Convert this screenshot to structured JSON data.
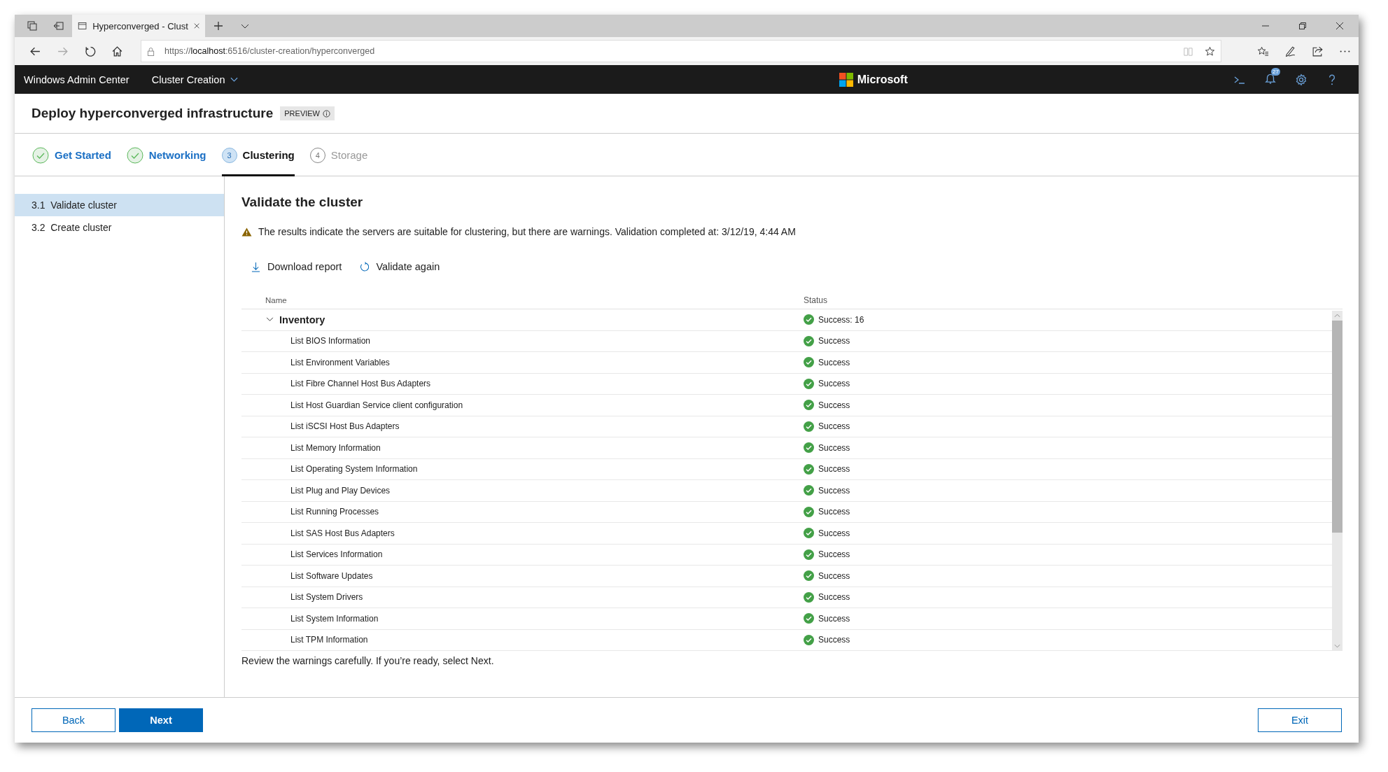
{
  "browser": {
    "tab_title": "Hyperconverged - Clust",
    "url_prefix": "https://",
    "url_host": "localhost",
    "url_rest": ":6516/cluster-creation/hyperconverged"
  },
  "app_header": {
    "app_name": "Windows Admin Center",
    "context": "Cluster Creation",
    "brand": "Microsoft",
    "notification_count": "27"
  },
  "page": {
    "title": "Deploy hyperconverged infrastructure",
    "badge": "PREVIEW"
  },
  "steps": [
    {
      "label": "Get Started",
      "kind": "done",
      "selected": false
    },
    {
      "label": "Networking",
      "kind": "done",
      "selected": false
    },
    {
      "label": "Clustering",
      "number": "3",
      "kind": "current",
      "selected": true
    },
    {
      "label": "Storage",
      "number": "4",
      "kind": "upcoming",
      "selected": false
    }
  ],
  "sidebar": {
    "items": [
      {
        "label": "3.1  Validate cluster",
        "selected": true
      },
      {
        "label": "3.2  Create cluster",
        "selected": false
      }
    ]
  },
  "content": {
    "heading": "Validate the cluster",
    "warning": "The results indicate the servers are suitable for clustering, but there are warnings. Validation completed at: 3/12/19, 4:44 AM",
    "actions": [
      {
        "kind": "download",
        "label": "Download report"
      },
      {
        "kind": "refresh",
        "label": "Validate again"
      }
    ],
    "table": {
      "columns": [
        "Name",
        "Status"
      ],
      "groups": [
        {
          "name": "Inventory",
          "status": "Success: 16",
          "expanded": true,
          "children": [
            {
              "name": "List BIOS Information",
              "status": "Success"
            },
            {
              "name": "List Environment Variables",
              "status": "Success"
            },
            {
              "name": "List Fibre Channel Host Bus Adapters",
              "status": "Success"
            },
            {
              "name": "List Host Guardian Service client configuration",
              "status": "Success"
            },
            {
              "name": "List iSCSI Host Bus Adapters",
              "status": "Success"
            },
            {
              "name": "List Memory Information",
              "status": "Success"
            },
            {
              "name": "List Operating System Information",
              "status": "Success"
            },
            {
              "name": "List Plug and Play Devices",
              "status": "Success"
            },
            {
              "name": "List Running Processes",
              "status": "Success"
            },
            {
              "name": "List SAS Host Bus Adapters",
              "status": "Success"
            },
            {
              "name": "List Services Information",
              "status": "Success"
            },
            {
              "name": "List Software Updates",
              "status": "Success"
            },
            {
              "name": "List System Drivers",
              "status": "Success"
            },
            {
              "name": "List System Information",
              "status": "Success"
            },
            {
              "name": "List TPM Information",
              "status": "Success"
            }
          ]
        }
      ]
    },
    "note": "Review the warnings carefully. If you’re ready, select Next."
  },
  "footer": {
    "buttons": [
      {
        "label": "Back",
        "kind": "secondary"
      },
      {
        "label": "Next",
        "kind": "primary"
      },
      {
        "label": "Exit",
        "kind": "secondary"
      }
    ]
  }
}
